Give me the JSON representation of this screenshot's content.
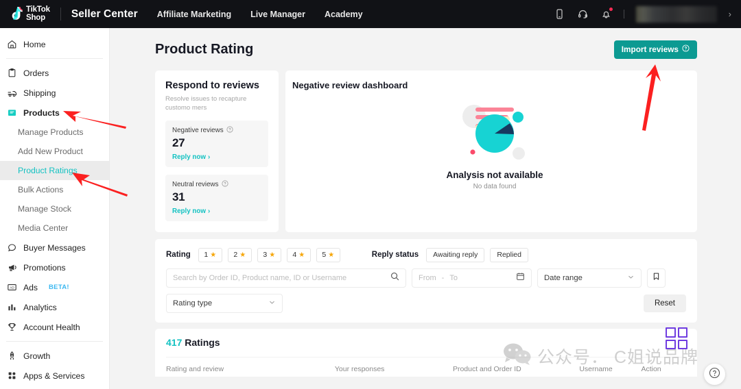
{
  "topbar": {
    "logo": {
      "line1": "TikTok",
      "line2": "Shop",
      "icon": "tiktok-note-icon"
    },
    "seller_center": "Seller Center",
    "nav": [
      {
        "label": "Affiliate Marketing"
      },
      {
        "label": "Live Manager"
      },
      {
        "label": "Academy"
      }
    ],
    "icons": [
      {
        "name": "mobile-icon"
      },
      {
        "name": "headset-support-icon"
      },
      {
        "name": "bell-notification-icon",
        "badge": true
      }
    ],
    "background": "#111216",
    "user_area": "blurred-account-name"
  },
  "sidebar": {
    "items": [
      {
        "label": "Home",
        "icon": "home-icon",
        "type": "item"
      },
      {
        "type": "separator"
      },
      {
        "label": "Orders",
        "icon": "clipboard-icon",
        "type": "item"
      },
      {
        "label": "Shipping",
        "icon": "truck-icon",
        "type": "item"
      },
      {
        "label": "Products",
        "icon": "products-box-icon",
        "type": "item",
        "bold": true
      },
      {
        "label": "Manage Products",
        "type": "sub"
      },
      {
        "label": "Add New Product",
        "type": "sub"
      },
      {
        "label": "Product Ratings",
        "type": "sub",
        "active": true
      },
      {
        "label": "Bulk Actions",
        "type": "sub"
      },
      {
        "label": "Manage Stock",
        "type": "sub"
      },
      {
        "label": "Media Center",
        "type": "sub"
      },
      {
        "label": "Buyer Messages",
        "icon": "chat-bubble-icon",
        "type": "item"
      },
      {
        "label": "Promotions",
        "icon": "megaphone-icon",
        "type": "item"
      },
      {
        "label": "Ads",
        "icon": "ad-icon",
        "type": "item",
        "badge": "BETA!"
      },
      {
        "label": "Analytics",
        "icon": "bar-chart-icon",
        "type": "item"
      },
      {
        "label": "Account Health",
        "icon": "trophy-icon",
        "type": "item"
      },
      {
        "type": "separator"
      },
      {
        "label": "Growth",
        "icon": "rocket-icon",
        "type": "item"
      },
      {
        "label": "Apps & Services",
        "icon": "grid-apps-icon",
        "type": "item"
      }
    ],
    "active_color": "#13c2c2",
    "badge_color": "#3cb8f0"
  },
  "page": {
    "title": "Product Rating",
    "import_button": {
      "label": "Import reviews",
      "icon": "question-circle-icon",
      "color": "#0c9a92"
    }
  },
  "respond_card": {
    "title": "Respond to reviews",
    "subtitle": "Resolve issues to recapture customo mers",
    "stats": [
      {
        "label": "Negative reviews",
        "value": "27",
        "link": "Reply now",
        "help_icon": "question-circle-icon"
      },
      {
        "label": "Neutral reviews",
        "value": "31",
        "link": "Reply now",
        "help_icon": "question-circle-icon"
      }
    ],
    "link_color": "#13c2c2"
  },
  "dashboard_card": {
    "title": "Negative review dashboard",
    "empty_title": "Analysis not available",
    "empty_sub": "No data found",
    "illustration": "pie-chart-empty-state-illustration"
  },
  "filters": {
    "rating_label": "Rating",
    "rating_chips": [
      {
        "label": "1",
        "star": "★"
      },
      {
        "label": "2",
        "star": "★"
      },
      {
        "label": "3",
        "star": "★"
      },
      {
        "label": "4",
        "star": "★"
      },
      {
        "label": "5",
        "star": "★"
      }
    ],
    "reply_status_label": "Reply status",
    "reply_status_chips": [
      {
        "label": "Awaiting reply"
      },
      {
        "label": "Replied"
      }
    ],
    "search_placeholder": "Search by Order ID, Product name, ID or Username",
    "search_value": "",
    "date_from_placeholder": "From",
    "date_separator": "-",
    "date_to_placeholder": "To",
    "date_range_label": "Date range",
    "rating_type_label": "Rating type",
    "bookmark_icon": "bookmark-icon",
    "reset_label": "Reset",
    "search_icon": "search-icon",
    "calendar_icon": "calendar-icon",
    "chevron_icon": "chevron-down-icon"
  },
  "table": {
    "count": "417",
    "count_suffix": "Ratings",
    "columns": [
      {
        "label": "Rating and review"
      },
      {
        "label": "Your responses"
      },
      {
        "label": "Product and Order ID"
      },
      {
        "label": "Username"
      },
      {
        "label": "Action"
      }
    ],
    "accent_color": "#13c2c2"
  },
  "overlays": {
    "watermark_text": "公众号． C姐说品牌",
    "watermark_icon": "wechat-icon",
    "grid_icon": "four-square-grid-icon",
    "grid_icon_color": "#6f3ce0",
    "help_fab_icon": "question-circle-icon",
    "annotation_arrows": [
      {
        "name": "arrow-to-products",
        "color": "#fb2020"
      },
      {
        "name": "arrow-to-product-ratings",
        "color": "#fb2020"
      },
      {
        "name": "arrow-to-import-reviews",
        "color": "#fb2020"
      }
    ]
  }
}
